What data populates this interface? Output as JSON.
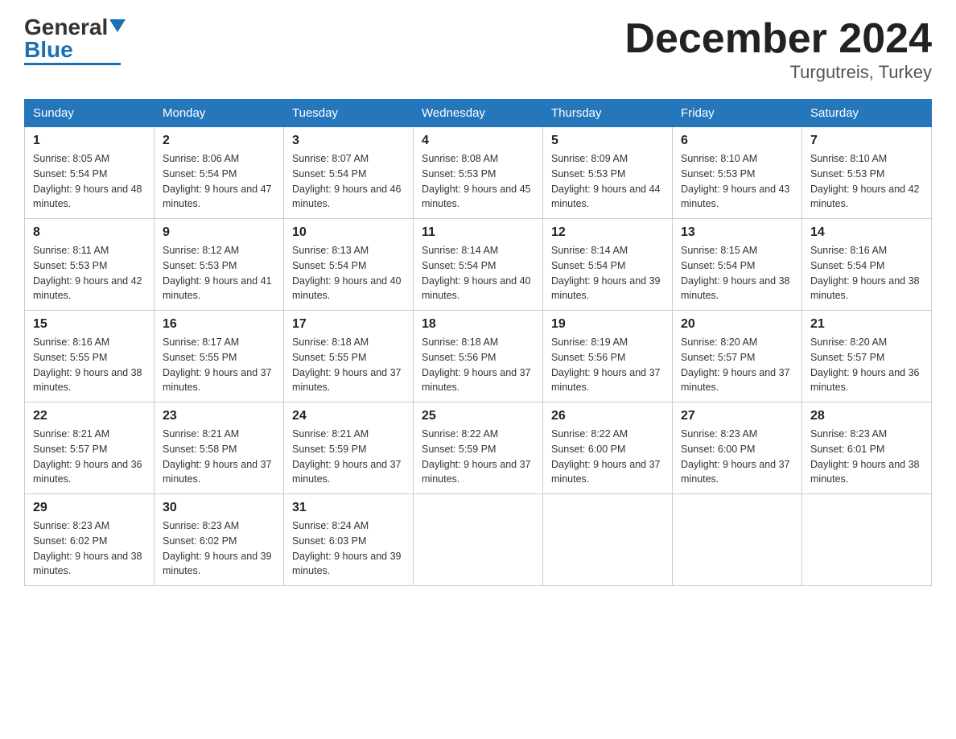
{
  "header": {
    "logo_general": "General",
    "logo_blue": "Blue",
    "title": "December 2024",
    "subtitle": "Turgutreis, Turkey"
  },
  "calendar": {
    "days_of_week": [
      "Sunday",
      "Monday",
      "Tuesday",
      "Wednesday",
      "Thursday",
      "Friday",
      "Saturday"
    ],
    "weeks": [
      [
        {
          "day": "1",
          "sunrise": "8:05 AM",
          "sunset": "5:54 PM",
          "daylight": "9 hours and 48 minutes."
        },
        {
          "day": "2",
          "sunrise": "8:06 AM",
          "sunset": "5:54 PM",
          "daylight": "9 hours and 47 minutes."
        },
        {
          "day": "3",
          "sunrise": "8:07 AM",
          "sunset": "5:54 PM",
          "daylight": "9 hours and 46 minutes."
        },
        {
          "day": "4",
          "sunrise": "8:08 AM",
          "sunset": "5:53 PM",
          "daylight": "9 hours and 45 minutes."
        },
        {
          "day": "5",
          "sunrise": "8:09 AM",
          "sunset": "5:53 PM",
          "daylight": "9 hours and 44 minutes."
        },
        {
          "day": "6",
          "sunrise": "8:10 AM",
          "sunset": "5:53 PM",
          "daylight": "9 hours and 43 minutes."
        },
        {
          "day": "7",
          "sunrise": "8:10 AM",
          "sunset": "5:53 PM",
          "daylight": "9 hours and 42 minutes."
        }
      ],
      [
        {
          "day": "8",
          "sunrise": "8:11 AM",
          "sunset": "5:53 PM",
          "daylight": "9 hours and 42 minutes."
        },
        {
          "day": "9",
          "sunrise": "8:12 AM",
          "sunset": "5:53 PM",
          "daylight": "9 hours and 41 minutes."
        },
        {
          "day": "10",
          "sunrise": "8:13 AM",
          "sunset": "5:54 PM",
          "daylight": "9 hours and 40 minutes."
        },
        {
          "day": "11",
          "sunrise": "8:14 AM",
          "sunset": "5:54 PM",
          "daylight": "9 hours and 40 minutes."
        },
        {
          "day": "12",
          "sunrise": "8:14 AM",
          "sunset": "5:54 PM",
          "daylight": "9 hours and 39 minutes."
        },
        {
          "day": "13",
          "sunrise": "8:15 AM",
          "sunset": "5:54 PM",
          "daylight": "9 hours and 38 minutes."
        },
        {
          "day": "14",
          "sunrise": "8:16 AM",
          "sunset": "5:54 PM",
          "daylight": "9 hours and 38 minutes."
        }
      ],
      [
        {
          "day": "15",
          "sunrise": "8:16 AM",
          "sunset": "5:55 PM",
          "daylight": "9 hours and 38 minutes."
        },
        {
          "day": "16",
          "sunrise": "8:17 AM",
          "sunset": "5:55 PM",
          "daylight": "9 hours and 37 minutes."
        },
        {
          "day": "17",
          "sunrise": "8:18 AM",
          "sunset": "5:55 PM",
          "daylight": "9 hours and 37 minutes."
        },
        {
          "day": "18",
          "sunrise": "8:18 AM",
          "sunset": "5:56 PM",
          "daylight": "9 hours and 37 minutes."
        },
        {
          "day": "19",
          "sunrise": "8:19 AM",
          "sunset": "5:56 PM",
          "daylight": "9 hours and 37 minutes."
        },
        {
          "day": "20",
          "sunrise": "8:20 AM",
          "sunset": "5:57 PM",
          "daylight": "9 hours and 37 minutes."
        },
        {
          "day": "21",
          "sunrise": "8:20 AM",
          "sunset": "5:57 PM",
          "daylight": "9 hours and 36 minutes."
        }
      ],
      [
        {
          "day": "22",
          "sunrise": "8:21 AM",
          "sunset": "5:57 PM",
          "daylight": "9 hours and 36 minutes."
        },
        {
          "day": "23",
          "sunrise": "8:21 AM",
          "sunset": "5:58 PM",
          "daylight": "9 hours and 37 minutes."
        },
        {
          "day": "24",
          "sunrise": "8:21 AM",
          "sunset": "5:59 PM",
          "daylight": "9 hours and 37 minutes."
        },
        {
          "day": "25",
          "sunrise": "8:22 AM",
          "sunset": "5:59 PM",
          "daylight": "9 hours and 37 minutes."
        },
        {
          "day": "26",
          "sunrise": "8:22 AM",
          "sunset": "6:00 PM",
          "daylight": "9 hours and 37 minutes."
        },
        {
          "day": "27",
          "sunrise": "8:23 AM",
          "sunset": "6:00 PM",
          "daylight": "9 hours and 37 minutes."
        },
        {
          "day": "28",
          "sunrise": "8:23 AM",
          "sunset": "6:01 PM",
          "daylight": "9 hours and 38 minutes."
        }
      ],
      [
        {
          "day": "29",
          "sunrise": "8:23 AM",
          "sunset": "6:02 PM",
          "daylight": "9 hours and 38 minutes."
        },
        {
          "day": "30",
          "sunrise": "8:23 AM",
          "sunset": "6:02 PM",
          "daylight": "9 hours and 39 minutes."
        },
        {
          "day": "31",
          "sunrise": "8:24 AM",
          "sunset": "6:03 PM",
          "daylight": "9 hours and 39 minutes."
        },
        null,
        null,
        null,
        null
      ]
    ]
  }
}
